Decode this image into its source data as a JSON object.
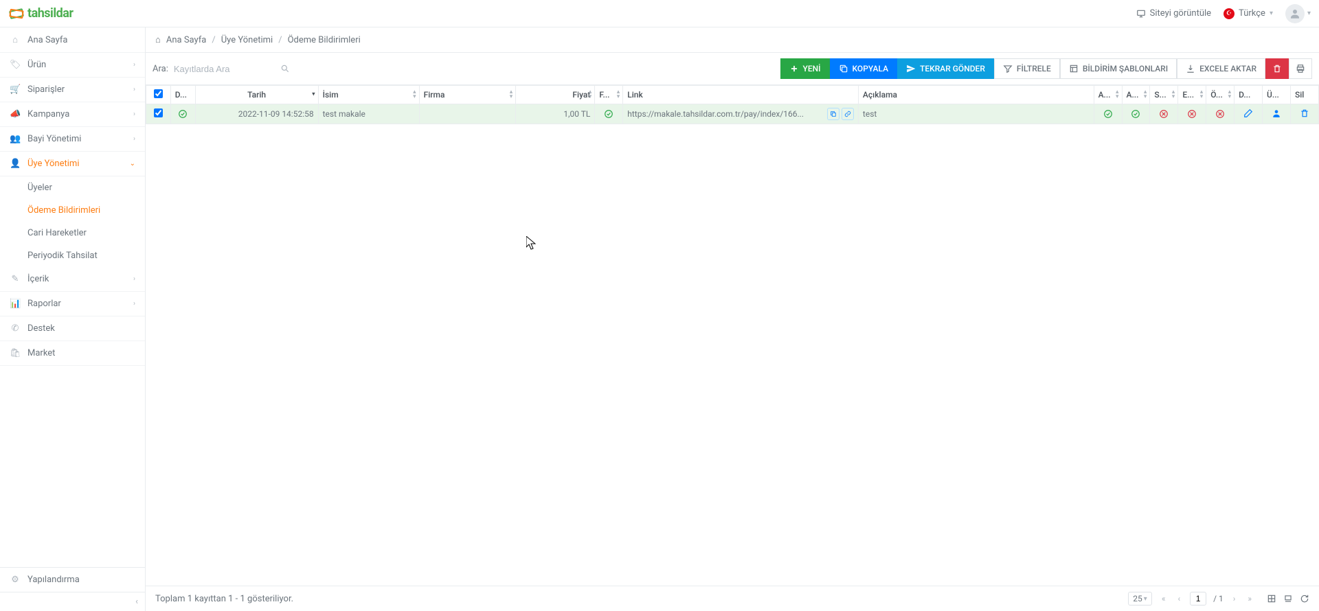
{
  "brand": {
    "name": "tahsildar"
  },
  "top": {
    "view_site": "Siteyi görüntüle",
    "language": "Türkçe"
  },
  "sidebar": {
    "items": [
      {
        "icon": "home",
        "label": "Ana Sayfa",
        "expandable": false
      },
      {
        "icon": "tag",
        "label": "Ürün",
        "expandable": true
      },
      {
        "icon": "cart",
        "label": "Siparişler",
        "expandable": true
      },
      {
        "icon": "bullhorn",
        "label": "Kampanya",
        "expandable": true
      },
      {
        "icon": "users",
        "label": "Bayi Yönetimi",
        "expandable": true
      },
      {
        "icon": "user",
        "label": "Üye Yönetimi",
        "expandable": true,
        "active": true,
        "sub": [
          {
            "label": "Üyeler"
          },
          {
            "label": "Ödeme Bildirimleri",
            "active": true
          },
          {
            "label": "Cari Hareketler"
          },
          {
            "label": "Periyodik Tahsilat"
          }
        ]
      },
      {
        "icon": "pencil",
        "label": "İçerik",
        "expandable": true
      },
      {
        "icon": "chart",
        "label": "Raporlar",
        "expandable": true
      },
      {
        "icon": "life-ring",
        "label": "Destek",
        "expandable": false
      },
      {
        "icon": "briefcase",
        "label": "Market",
        "expandable": false
      }
    ],
    "bottom": {
      "icon": "cog",
      "label": "Yapılandırma"
    }
  },
  "breadcrumb": {
    "home": "Ana Sayfa",
    "level1": "Üye Yönetimi",
    "level2": "Ödeme Bildirimleri"
  },
  "search": {
    "label": "Ara:",
    "placeholder": "Kayıtlarda Ara"
  },
  "toolbar": {
    "new": "YENİ",
    "copy": "KOPYALA",
    "resend": "TEKRAR GÖNDER",
    "filter": "FİLTRELE",
    "templates": "BİLDİRİM ŞABLONLARI",
    "excel": "EXCELE AKTAR"
  },
  "columns": {
    "d": "D...",
    "tarih": "Tarih",
    "isim": "İsim",
    "firma": "Firma",
    "fiyat": "Fiyat",
    "f2": "F...",
    "link": "Link",
    "aciklama": "Açıklama",
    "a1": "A...",
    "a2": "A...",
    "s": "S...",
    "e": "E...",
    "o": "Ö...",
    "d2": "D...",
    "u": "Ü...",
    "sil": "Sil"
  },
  "rows": [
    {
      "selected": true,
      "status": true,
      "tarih": "2022-11-09 14:52:58",
      "isim": "test makale",
      "firma": "",
      "fiyat": "1,00 TL",
      "f2": true,
      "link": "https://makale.tahsildar.com.tr/pay/index/166...",
      "aciklama": "test",
      "a1": true,
      "a2": true,
      "s": false,
      "e": false,
      "o": false
    }
  ],
  "footer": {
    "summary_prefix": "Toplam ",
    "summary_count": "1",
    "summary_mid": " kayıttan ",
    "summary_range": "1 - 1",
    "summary_suffix": " gösteriliyor.",
    "page_size": "25",
    "page_current": "1",
    "page_sep": "/",
    "page_total": "1"
  }
}
